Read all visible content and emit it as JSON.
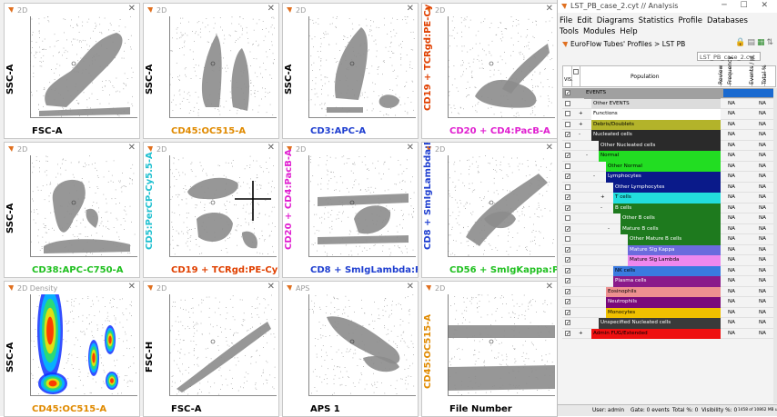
{
  "plots": [
    {
      "title": "2D",
      "xlabel": "FSC-A",
      "xcolor": "#000000",
      "ylabel": "SSC-A",
      "ycolor": "#000000",
      "shape": "s1"
    },
    {
      "title": "2D",
      "xlabel": "CD45:OC515-A",
      "xcolor": "#e08a00",
      "ylabel": "SSC-A",
      "ycolor": "#000000",
      "shape": "s2"
    },
    {
      "title": "2D",
      "xlabel": "CD3:APC-A",
      "xcolor": "#1f3fd0",
      "ylabel": "SSC-A",
      "ycolor": "#000000",
      "shape": "s3"
    },
    {
      "title": "2D",
      "xlabel": "CD20 + CD4:PacB-A",
      "xcolor": "#e020d0",
      "ylabel": "CD19 + TCRgd:PE-Cy7",
      "ycolor": "#e04000",
      "shape": "s4"
    },
    {
      "title": "2D",
      "xlabel": "CD38:APC-C750-A",
      "xcolor": "#20c020",
      "ylabel": "SSC-A",
      "ycolor": "#000000",
      "shape": "s5"
    },
    {
      "title": "2D",
      "xlabel": "CD19 + TCRgd:PE-Cy7-A",
      "xcolor": "#e04000",
      "ylabel": "CD5:PerCP-Cy5.5-A",
      "ycolor": "#20c0d0",
      "shape": "s6"
    },
    {
      "title": "2D",
      "xlabel": "CD8 + SmIgLambda:FIT",
      "xcolor": "#1f3fd0",
      "ylabel": "CD20 + CD4:PacB-A",
      "ycolor": "#e020d0",
      "shape": "s7"
    },
    {
      "title": "2D",
      "xlabel": "CD56 + SmIgKappa:PE-",
      "xcolor": "#20c020",
      "ylabel": "CD8 + SmIgLambda:F",
      "ycolor": "#1f3fd0",
      "shape": "s8"
    },
    {
      "title": "2D Density",
      "xlabel": "CD45:OC515-A",
      "xcolor": "#e08a00",
      "ylabel": "SSC-A",
      "ycolor": "#000000",
      "shape": "s9"
    },
    {
      "title": "2D",
      "xlabel": "FSC-A",
      "xcolor": "#000000",
      "ylabel": "FSC-H",
      "ycolor": "#000000",
      "shape": "s10"
    },
    {
      "title": "APS",
      "xlabel": "APS 1",
      "xcolor": "#000000",
      "ylabel": "",
      "ycolor": "#000000",
      "shape": "s11"
    },
    {
      "title": "2D",
      "xlabel": "File Number",
      "xcolor": "#000000",
      "ylabel": "CD45:OC515-A",
      "ycolor": "#e08a00",
      "shape": "s12"
    }
  ],
  "window": {
    "title": "LST_PB_case_2.cyt // Analysis"
  },
  "menu": [
    "File",
    "Edit",
    "Diagrams",
    "Statistics",
    "Profile",
    "Databases",
    "Tools",
    "Modules",
    "Help"
  ],
  "breadcrumb": {
    "part1": "EuroFlow Tubes' Profiles",
    "sep": ">",
    "part2": "LST PB"
  },
  "file_field": {
    "value": "LST_PB_case_2.cyt"
  },
  "header": {
    "vis": "VIS.",
    "population": "Population",
    "review": "Review",
    "frequency": "Frequency",
    "events": "Events / µl",
    "total": "Total %"
  },
  "populations": [
    {
      "label": "EVENTS",
      "color": "#a0a0a0",
      "text": "#000000",
      "indent": 0,
      "check": "v",
      "tree": "",
      "na1": "",
      "na2": "",
      "selected": true
    },
    {
      "label": "Other EVENTS",
      "color": "#dcdcdc",
      "text": "#000000",
      "indent": 8,
      "check": "",
      "tree": "",
      "na1": "NA",
      "na2": "NA"
    },
    {
      "label": "Functions",
      "color": "#ffffff",
      "text": "#000000",
      "indent": 8,
      "check": "",
      "tree": "+",
      "na1": "NA",
      "na2": "NA"
    },
    {
      "label": "Debris/Doublets",
      "color": "#b3b32a",
      "text": "#000000",
      "indent": 8,
      "check": "",
      "tree": "+",
      "na1": "NA",
      "na2": "NA"
    },
    {
      "label": "Nucleated cells",
      "color": "#2a2a2a",
      "text": "#ffffff",
      "indent": 8,
      "check": "v",
      "tree": "-",
      "na1": "NA",
      "na2": "NA"
    },
    {
      "label": "Other Nucleated cells",
      "color": "#2a2a2a",
      "text": "#ffffff",
      "indent": 16,
      "check": "",
      "tree": "",
      "na1": "NA",
      "na2": "NA"
    },
    {
      "label": "Normal",
      "color": "#22dd22",
      "text": "#000000",
      "indent": 16,
      "check": "v",
      "tree": "-",
      "na1": "NA",
      "na2": "NA"
    },
    {
      "label": "Other Normal",
      "color": "#22dd22",
      "text": "#000000",
      "indent": 24,
      "check": "",
      "tree": "",
      "na1": "NA",
      "na2": "NA"
    },
    {
      "label": "Lymphocytes",
      "color": "#0a1a8a",
      "text": "#ffffff",
      "indent": 24,
      "check": "v",
      "tree": "-",
      "na1": "NA",
      "na2": "NA"
    },
    {
      "label": "Other Lymphocytes",
      "color": "#0a1a8a",
      "text": "#ffffff",
      "indent": 32,
      "check": "",
      "tree": "",
      "na1": "NA",
      "na2": "NA"
    },
    {
      "label": "T cells",
      "color": "#22dddd",
      "text": "#000000",
      "indent": 32,
      "check": "v",
      "tree": "+",
      "na1": "NA",
      "na2": "NA"
    },
    {
      "label": "B cells",
      "color": "#1e7a1e",
      "text": "#ffffff",
      "indent": 32,
      "check": "v",
      "tree": "-",
      "na1": "NA",
      "na2": "NA"
    },
    {
      "label": "Other B cells",
      "color": "#1e7a1e",
      "text": "#ffffff",
      "indent": 40,
      "check": "",
      "tree": "",
      "na1": "NA",
      "na2": "NA"
    },
    {
      "label": "Mature B cells",
      "color": "#1e7a1e",
      "text": "#ffffff",
      "indent": 40,
      "check": "v",
      "tree": "-",
      "na1": "NA",
      "na2": "NA"
    },
    {
      "label": "Other Mature B cells",
      "color": "#1e7a1e",
      "text": "#ffffff",
      "indent": 48,
      "check": "",
      "tree": "",
      "na1": "NA",
      "na2": "NA"
    },
    {
      "label": "Mature SIg Kappa",
      "color": "#6b6bdd",
      "text": "#ffffff",
      "indent": 48,
      "check": "v",
      "tree": "",
      "na1": "NA",
      "na2": "NA"
    },
    {
      "label": "Mature SIg Lambda",
      "color": "#ee88ee",
      "text": "#000000",
      "indent": 48,
      "check": "v",
      "tree": "",
      "na1": "NA",
      "na2": "NA"
    },
    {
      "label": "NK cells",
      "color": "#3a7ae0",
      "text": "#000000",
      "indent": 32,
      "check": "v",
      "tree": "",
      "na1": "NA",
      "na2": "NA"
    },
    {
      "label": "Plasma cells",
      "color": "#8a1a8a",
      "text": "#ffffff",
      "indent": 32,
      "check": "v",
      "tree": "",
      "na1": "NA",
      "na2": "NA"
    },
    {
      "label": "Eosinophils",
      "color": "#ee9090",
      "text": "#000000",
      "indent": 24,
      "check": "v",
      "tree": "",
      "na1": "NA",
      "na2": "NA"
    },
    {
      "label": "Neutrophils",
      "color": "#7a0a7a",
      "text": "#ffffff",
      "indent": 24,
      "check": "v",
      "tree": "",
      "na1": "NA",
      "na2": "NA"
    },
    {
      "label": "Monocytes",
      "color": "#f0c000",
      "text": "#000000",
      "indent": 24,
      "check": "v",
      "tree": "",
      "na1": "NA",
      "na2": "NA"
    },
    {
      "label": "Unspecified Nucleated cells",
      "color": "#3a3a3a",
      "text": "#ffffff",
      "indent": 16,
      "check": "v",
      "tree": "",
      "na1": "NA",
      "na2": "NA"
    },
    {
      "label": "Admin FUG/Extended",
      "color": "#ee1010",
      "text": "#000000",
      "indent": 8,
      "check": "v",
      "tree": "+",
      "na1": "NA",
      "na2": "NA"
    }
  ],
  "status": {
    "user": "User: admin",
    "gate": "Gate: 0 events",
    "total": "Total %: 0",
    "visibility": "Visibility %: 0",
    "memory": "1458 of 10862 MB used"
  }
}
